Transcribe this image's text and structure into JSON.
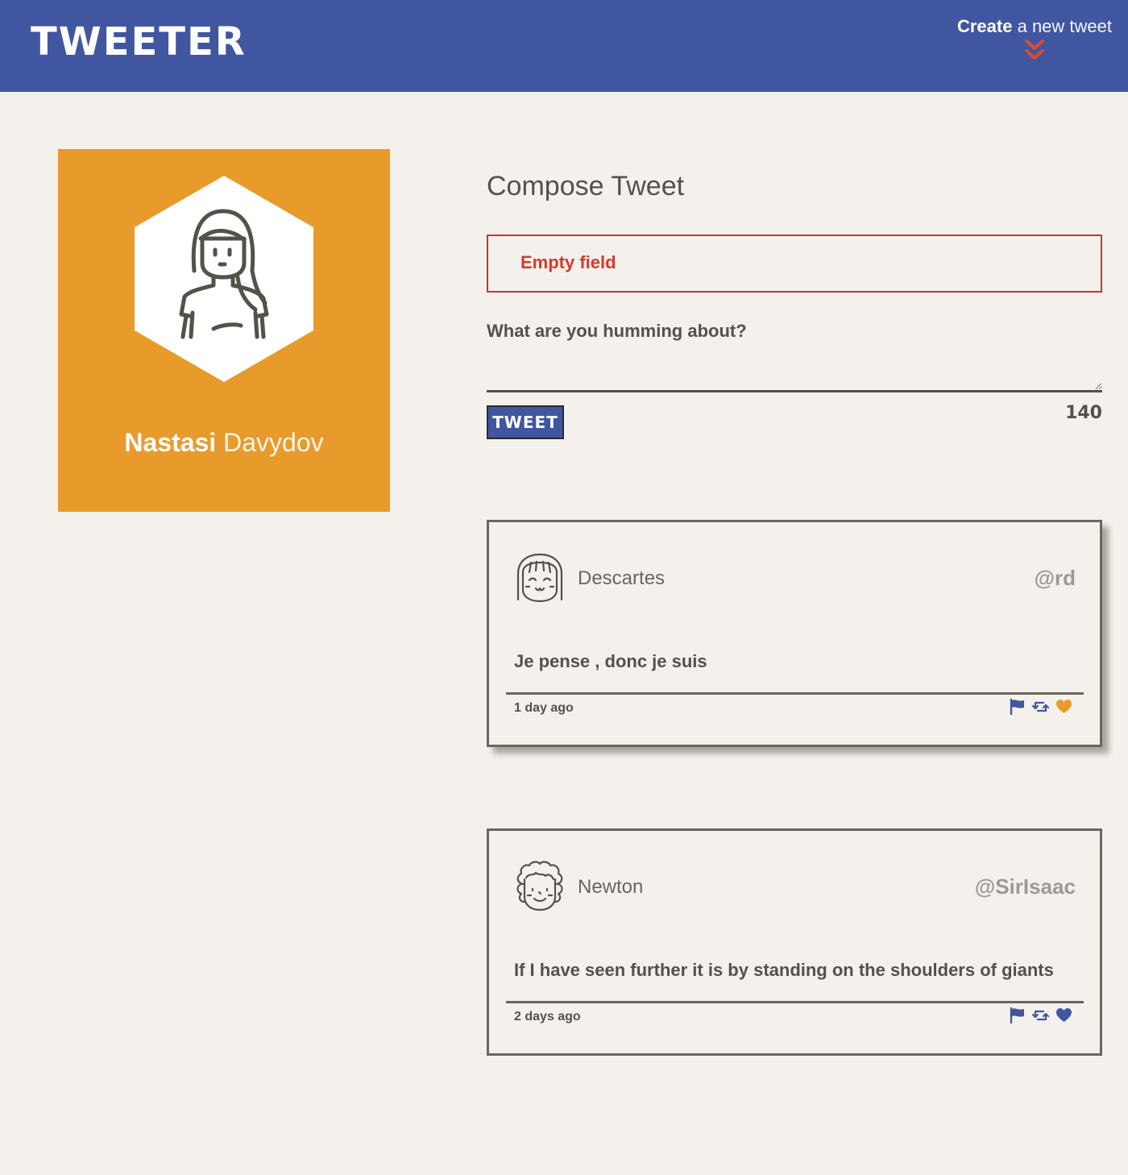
{
  "nav": {
    "logo": "TWEETER",
    "create_bold": "Create",
    "create_rest": "a new tweet",
    "accent_color": "#4056a1",
    "chevron_color": "#e24a2b"
  },
  "profile": {
    "first_name": "Nastasi",
    "last_name": "Davydov",
    "background_color": "#e89b2a"
  },
  "compose": {
    "title": "Compose Tweet",
    "error": "Empty field",
    "label": "What are you humming about?",
    "input_value": "",
    "button_label": "TWEET",
    "counter": "140"
  },
  "tweets": [
    {
      "name": "Descartes",
      "handle": "@rd",
      "content": "Je pense , donc je suis",
      "time": "1 day ago",
      "liked": true,
      "like_color": "#e89b2a"
    },
    {
      "name": "Newton",
      "handle": "@SirIsaac",
      "content": "If I have seen further it is by standing on the shoulders of giants",
      "time": "2 days ago",
      "liked": false,
      "like_color": "#4056a1"
    }
  ],
  "icons": [
    "chevron-double-down",
    "avatar-woman",
    "avatar-descartes",
    "avatar-newton",
    "flag",
    "retweet",
    "heart"
  ]
}
